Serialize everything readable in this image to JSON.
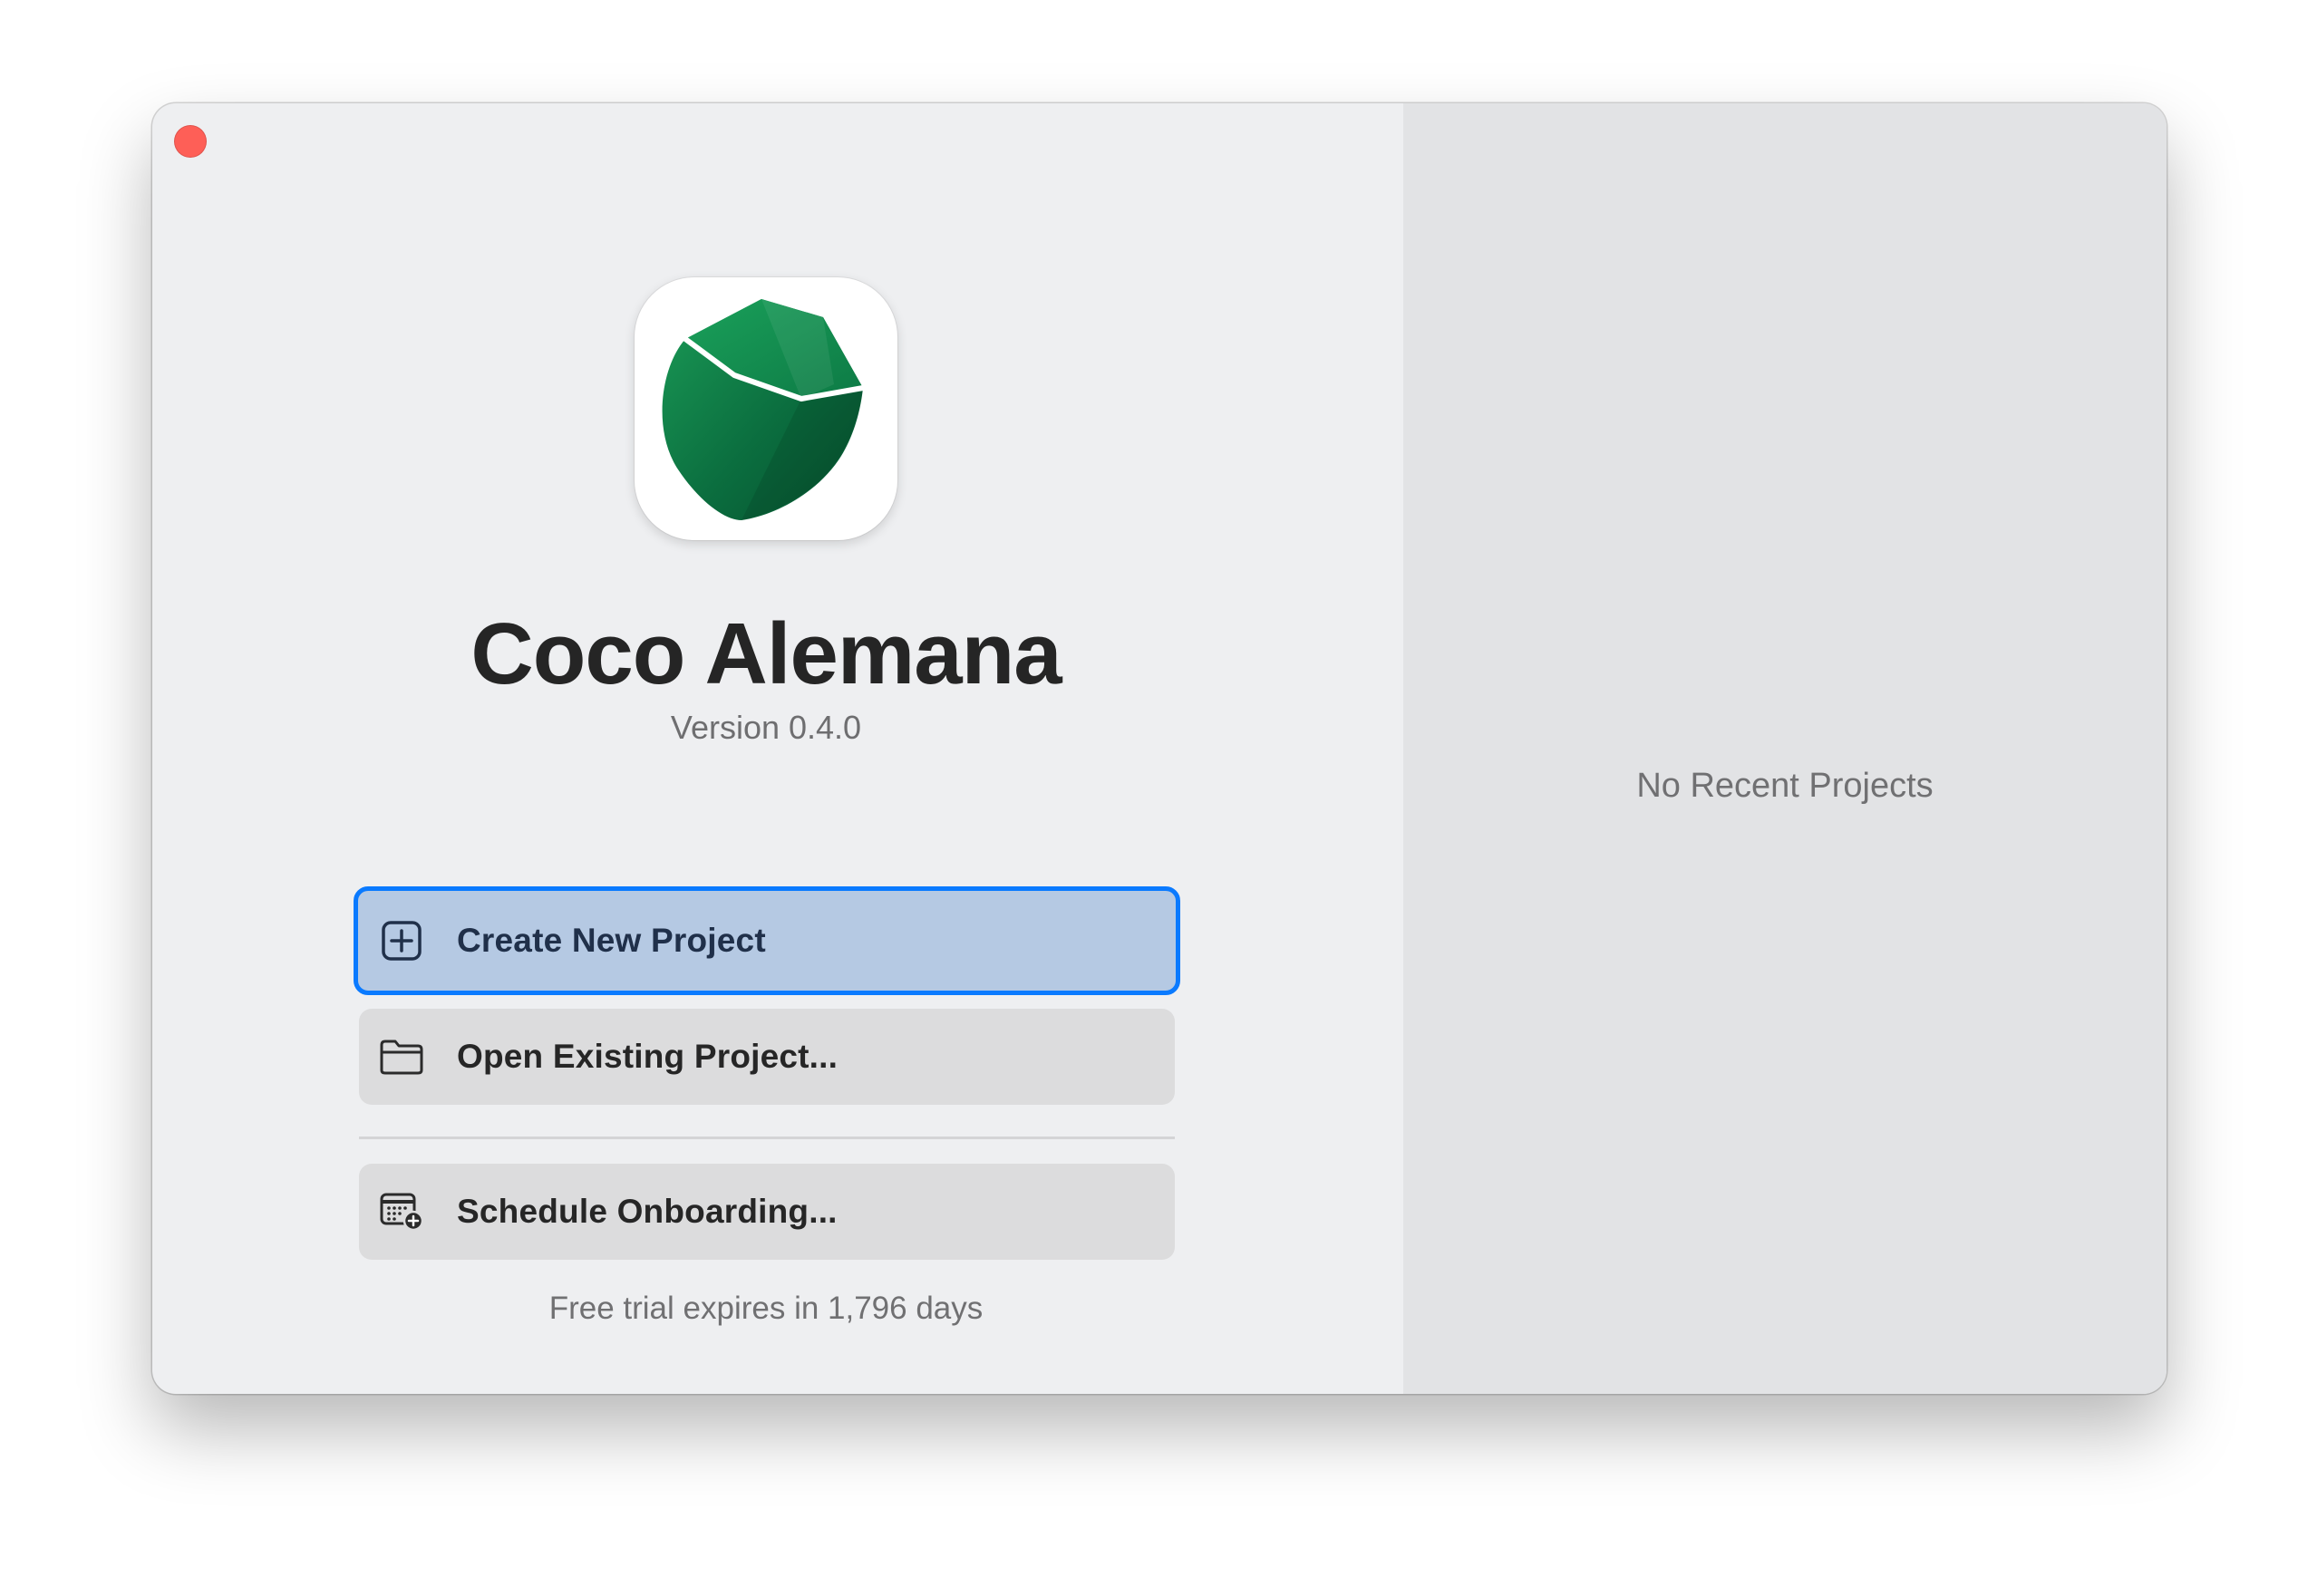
{
  "window": {
    "close_button": "close"
  },
  "app": {
    "name": "Coco Alemana",
    "version": "Version 0.4.0",
    "icon": "coconut-icon"
  },
  "actions": [
    {
      "label": "Create New Project",
      "icon": "plus-square-icon",
      "selected": true
    },
    {
      "label": "Open Existing Project...",
      "icon": "folder-icon",
      "selected": false
    },
    {
      "label": "Schedule Onboarding...",
      "icon": "calendar-plus-icon",
      "selected": false
    }
  ],
  "trial": {
    "text": "Free trial expires in 1,796 days"
  },
  "recent_projects": {
    "empty_text": "No Recent Projects"
  },
  "colors": {
    "accent": "#0a7aff",
    "selected_fill": "#b5c9e3",
    "close": "#fe5f57",
    "icon_green": "#0f7a45"
  }
}
